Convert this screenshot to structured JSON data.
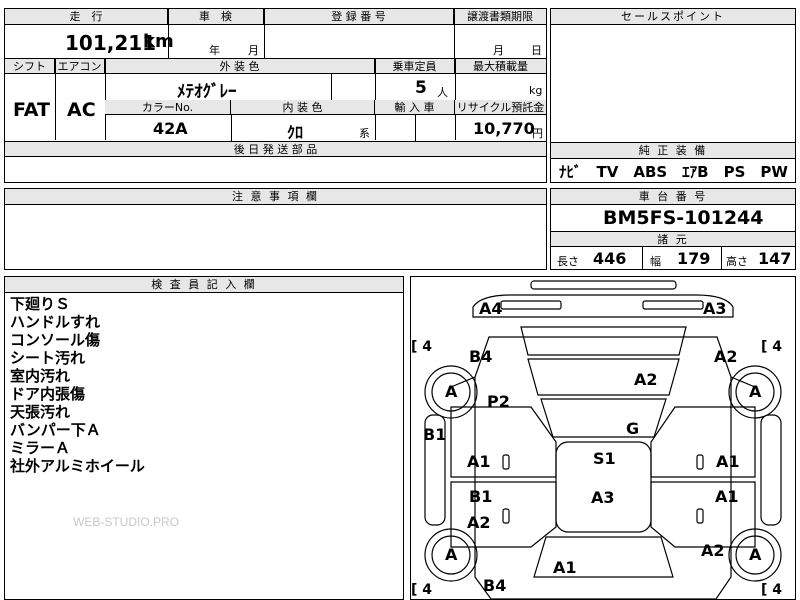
{
  "header": {
    "mileage_label": "走　行",
    "inspection_label": "車　検",
    "registration_label": "登 録 番 号",
    "transfer_label": "譲渡書類期限",
    "sales_point_label": "セールスポイント"
  },
  "values": {
    "mileage": "101,211",
    "mileage_unit": "km",
    "inspection_year": "年",
    "inspection_month": "月",
    "transfer_month": "月",
    "transfer_day": "日"
  },
  "row2": {
    "shift_label": "シフト",
    "ac_label": "エアコン",
    "exterior_label": "外 装 色",
    "capacity_label": "乗車定員",
    "max_load_label": "最大積載量",
    "shift": "FAT",
    "ac": "AC",
    "exterior_color": "ﾒﾃｵｸﾞﾚｰ",
    "capacity": "5",
    "capacity_unit": "人",
    "load_unit": "kg",
    "color_no_label": "カラーNo.",
    "interior_label": "内 装 色",
    "import_label": "輸 入 車",
    "recycle_label": "リサイクル預託金",
    "color_no": "42A",
    "interior": "ｸﾛ",
    "interior_suffix": "系",
    "recycle": "10,770",
    "recycle_unit": "円",
    "later_parts_label": "後 日 発 送 部 品"
  },
  "equipment": {
    "label": "純 正 装 備",
    "value": "ﾅﾋﾞ　TV　ABS　ｴｱB　PS　PW"
  },
  "notes": {
    "label": "注 意 事 項 欄"
  },
  "chassis": {
    "label": "車 台 番 号",
    "value": "BM5FS-101244",
    "specs_label": "諸 元",
    "length_label": "長さ",
    "length": "446",
    "width_label": "幅",
    "width": "179",
    "height_label": "高さ",
    "height": "147"
  },
  "inspector": {
    "label": "検 査 員 記 入 欄",
    "lines": [
      "下廻りＳ",
      "ハンドルすれ",
      "コンソール傷",
      "シート汚れ",
      "室内汚れ",
      "ドア内張傷",
      "天張汚れ",
      "バンパー下Ａ",
      "ミラーＡ",
      "社外アルミホイール"
    ],
    "watermark": "WEB-STUDIO.PRO"
  },
  "diagram": {
    "labels": {
      "a4": "A4",
      "a3": "A3",
      "b4_top": "B4",
      "a2_right_top": "A2",
      "a2_center": "A2",
      "p2": "P2",
      "g": "G",
      "b1_left": "B1",
      "a1_left_top": "A1",
      "s1": "S1",
      "a1_right_top": "A1",
      "b1_mid": "B1",
      "a3_center": "A3",
      "a1_right_mid": "A1",
      "a2_left_mid": "A2",
      "a2_right_low": "A2",
      "a1_bottom": "A1",
      "b4_bottom": "B4",
      "wheel": "A",
      "tire_depth": "4",
      "bracket_open": "[",
      "bracket_close": "["
    }
  }
}
